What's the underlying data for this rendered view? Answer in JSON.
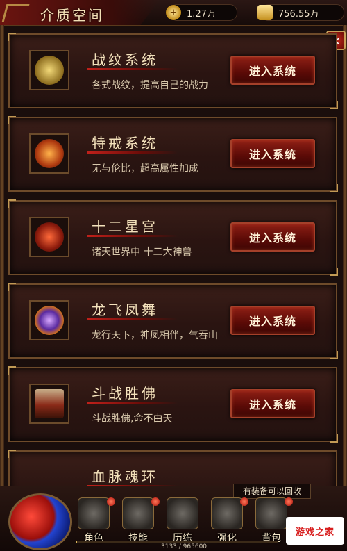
{
  "header": {
    "title": "介质空间",
    "gold": {
      "icon": "gold-coin-icon",
      "value": "1.27万"
    },
    "ingot": {
      "icon": "gold-ingot-icon",
      "value": "756.55万"
    }
  },
  "systems": [
    {
      "name": "战纹系统",
      "desc": "各式战纹，提高自己的战力",
      "button": "进入系统",
      "icon": "battle-pattern-icon"
    },
    {
      "name": "特戒系统",
      "desc": "无与伦比，超高属性加成",
      "button": "进入系统",
      "icon": "special-ring-icon"
    },
    {
      "name": "十二星宫",
      "desc": "诸天世界中 十二大神兽",
      "button": "进入系统",
      "icon": "zodiac-icon"
    },
    {
      "name": "龙飞凤舞",
      "desc": "龙行天下，神凤相伴，气吞山",
      "button": "进入系统",
      "icon": "dragon-phoenix-icon"
    },
    {
      "name": "斗战胜佛",
      "desc": "斗战胜佛,命不由天",
      "button": "进入系统",
      "icon": "buddha-icon"
    },
    {
      "name": "血脉魂环",
      "desc": "",
      "button": "",
      "icon": "soul-ring-icon"
    }
  ],
  "bottom_nav": [
    {
      "label": "角色",
      "icon": "character-icon"
    },
    {
      "label": "技能",
      "icon": "skill-book-icon"
    },
    {
      "label": "历练",
      "icon": "training-icon"
    },
    {
      "label": "强化",
      "icon": "forge-hammer-icon"
    },
    {
      "label": "背包",
      "icon": "backpack-icon"
    }
  ],
  "tooltip": "有装备可以回收",
  "exp": {
    "text": "3133 / 965600",
    "progress": 0.0032
  },
  "watermark": "游戏之家",
  "colors": {
    "accent": "#8e1f15",
    "gold": "#c19a55",
    "panel": "#2a1411"
  }
}
